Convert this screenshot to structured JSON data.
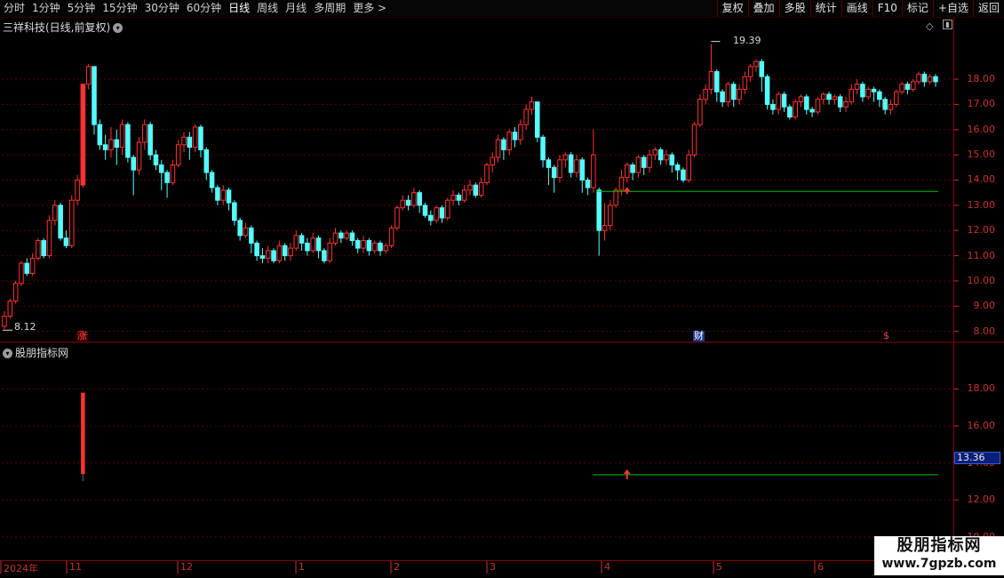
{
  "toolbar": {
    "periods": [
      "分时",
      "1分钟",
      "5分钟",
      "15分钟",
      "30分钟",
      "60分钟",
      "日线",
      "周线",
      "月线",
      "多周期",
      "更多 >"
    ],
    "active_period": "日线",
    "tools": [
      "复权",
      "叠加",
      "多股",
      "统计",
      "画线",
      "F10",
      "标记",
      "+自选",
      "返回"
    ]
  },
  "price_panel": {
    "title": "三祥科技(日线,前复权)",
    "high_annotation": "19.39",
    "low_annotation": "8.12",
    "markers": {
      "limit_up": "涨",
      "finance": "财",
      "dividend": "$"
    }
  },
  "indicator_panel": {
    "title": "股朋指标网",
    "current_value": "13.36"
  },
  "timeline": [
    "2024年",
    "11",
    "12",
    "1",
    "2",
    "3",
    "4",
    "5",
    "6"
  ],
  "watermark": {
    "name": "股朋指标网",
    "url": "www.7gpzb.com"
  },
  "colors": {
    "up": "#ff3232",
    "down": "#54ffff",
    "line": "#00c000",
    "grid": "#5a0000",
    "axis": "#c83232"
  },
  "chart_data": [
    {
      "type": "candlestick",
      "title": "三祥科技(日线,前复权)",
      "y_ticks": [
        8.0,
        9.0,
        10.0,
        11.0,
        12.0,
        13.0,
        14.0,
        15.0,
        16.0,
        17.0,
        18.0
      ],
      "ylim": [
        7.6,
        19.8
      ],
      "x_months": [
        "2024年",
        "11",
        "12",
        "1",
        "2",
        "3",
        "4",
        "5",
        "6"
      ],
      "max_price": 19.39,
      "min_price": 8.12,
      "reference_line": 13.55,
      "candles": [
        [
          8.2,
          8.6,
          8.1,
          8.8
        ],
        [
          8.6,
          9.2,
          8.5,
          9.3
        ],
        [
          9.2,
          9.9,
          9.1,
          10.0
        ],
        [
          9.9,
          10.7,
          9.8,
          10.8
        ],
        [
          10.7,
          10.3,
          10.2,
          10.9
        ],
        [
          10.3,
          10.9,
          10.2,
          11.1
        ],
        [
          10.9,
          11.6,
          10.8,
          11.7
        ],
        [
          11.6,
          11.0,
          10.9,
          11.7
        ],
        [
          11.0,
          12.4,
          10.9,
          12.6
        ],
        [
          12.4,
          13.0,
          12.2,
          13.2
        ],
        [
          13.0,
          11.7,
          11.6,
          13.1
        ],
        [
          11.7,
          11.4,
          11.3,
          12.0
        ],
        [
          11.4,
          13.2,
          11.3,
          13.4
        ],
        [
          13.2,
          14.0,
          13.0,
          14.2
        ],
        [
          13.8,
          17.8,
          13.7,
          17.8
        ],
        [
          17.8,
          18.5,
          17.6,
          18.6
        ],
        [
          18.5,
          16.2,
          15.8,
          18.5
        ],
        [
          16.2,
          15.4,
          15.2,
          16.4
        ],
        [
          15.4,
          15.2,
          14.8,
          15.8
        ],
        [
          15.2,
          15.6,
          14.9,
          16.1
        ],
        [
          15.6,
          15.3,
          14.6,
          16.0
        ],
        [
          15.3,
          16.2,
          15.0,
          16.4
        ],
        [
          16.2,
          14.9,
          14.7,
          16.3
        ],
        [
          14.9,
          14.4,
          13.4,
          15.0
        ],
        [
          14.4,
          15.5,
          14.2,
          15.7
        ],
        [
          15.5,
          16.2,
          15.2,
          16.4
        ],
        [
          16.2,
          15.0,
          14.8,
          16.3
        ],
        [
          15.0,
          14.6,
          14.4,
          15.2
        ],
        [
          14.6,
          14.3,
          13.6,
          14.8
        ],
        [
          14.3,
          13.9,
          13.3,
          14.4
        ],
        [
          13.9,
          14.6,
          13.8,
          14.8
        ],
        [
          14.6,
          15.4,
          14.5,
          15.6
        ],
        [
          15.4,
          15.7,
          15.1,
          15.9
        ],
        [
          15.7,
          15.3,
          14.8,
          15.9
        ],
        [
          15.3,
          16.1,
          15.1,
          16.2
        ],
        [
          16.1,
          15.2,
          14.9,
          16.2
        ],
        [
          15.2,
          14.3,
          14.0,
          15.3
        ],
        [
          14.3,
          13.7,
          13.5,
          14.4
        ],
        [
          13.7,
          13.2,
          13.0,
          13.8
        ],
        [
          13.2,
          13.6,
          13.0,
          13.8
        ],
        [
          13.6,
          13.1,
          12.8,
          13.7
        ],
        [
          13.1,
          12.4,
          12.2,
          13.2
        ],
        [
          12.4,
          11.8,
          11.6,
          12.5
        ],
        [
          11.8,
          12.1,
          11.7,
          12.3
        ],
        [
          12.1,
          11.5,
          11.1,
          12.2
        ],
        [
          11.5,
          11.0,
          10.8,
          11.6
        ],
        [
          11.0,
          10.9,
          10.7,
          11.3
        ],
        [
          10.9,
          11.2,
          10.7,
          11.4
        ],
        [
          11.2,
          10.8,
          10.7,
          11.3
        ],
        [
          10.8,
          11.4,
          10.7,
          11.6
        ],
        [
          11.4,
          11.0,
          10.8,
          11.5
        ],
        [
          11.0,
          11.3,
          10.8,
          11.5
        ],
        [
          11.3,
          11.8,
          11.2,
          12.0
        ],
        [
          11.8,
          11.5,
          11.2,
          11.9
        ],
        [
          11.5,
          11.2,
          11.0,
          11.7
        ],
        [
          11.2,
          11.7,
          11.1,
          11.9
        ],
        [
          11.7,
          11.2,
          10.9,
          11.8
        ],
        [
          11.2,
          10.8,
          10.7,
          11.3
        ],
        [
          10.8,
          11.5,
          10.7,
          11.7
        ],
        [
          11.5,
          11.9,
          11.4,
          12.1
        ],
        [
          11.9,
          11.7,
          11.5,
          12.0
        ],
        [
          11.7,
          11.9,
          11.6,
          12.0
        ],
        [
          11.9,
          11.6,
          11.4,
          12.0
        ],
        [
          11.6,
          11.3,
          11.1,
          11.7
        ],
        [
          11.3,
          11.6,
          11.1,
          11.8
        ],
        [
          11.6,
          11.2,
          11.0,
          11.7
        ],
        [
          11.2,
          11.5,
          11.1,
          11.6
        ],
        [
          11.5,
          11.2,
          11.0,
          11.6
        ],
        [
          11.2,
          11.4,
          11.1,
          11.5
        ],
        [
          11.4,
          12.1,
          11.3,
          12.2
        ],
        [
          12.1,
          12.9,
          12.0,
          13.0
        ],
        [
          12.9,
          13.2,
          12.8,
          13.4
        ],
        [
          13.2,
          13.0,
          12.8,
          13.4
        ],
        [
          13.0,
          13.5,
          12.9,
          13.7
        ],
        [
          13.5,
          13.0,
          12.7,
          13.6
        ],
        [
          13.0,
          12.6,
          12.5,
          13.1
        ],
        [
          12.6,
          12.4,
          12.2,
          12.8
        ],
        [
          12.4,
          12.9,
          12.3,
          13.0
        ],
        [
          12.9,
          12.5,
          12.3,
          13.0
        ],
        [
          12.5,
          13.2,
          12.4,
          13.3
        ],
        [
          13.2,
          13.4,
          13.0,
          13.6
        ],
        [
          13.4,
          13.2,
          13.0,
          13.5
        ],
        [
          13.2,
          13.6,
          13.1,
          13.8
        ],
        [
          13.6,
          13.8,
          13.4,
          14.0
        ],
        [
          13.8,
          13.4,
          13.3,
          13.9
        ],
        [
          13.4,
          13.9,
          13.3,
          14.1
        ],
        [
          13.9,
          14.6,
          13.8,
          14.7
        ],
        [
          14.6,
          14.9,
          14.3,
          15.1
        ],
        [
          14.9,
          15.6,
          14.7,
          15.8
        ],
        [
          15.6,
          15.2,
          14.8,
          15.7
        ],
        [
          15.2,
          15.9,
          15.0,
          16.0
        ],
        [
          15.9,
          15.6,
          15.3,
          16.1
        ],
        [
          15.6,
          16.2,
          15.4,
          16.4
        ],
        [
          16.2,
          16.8,
          16.0,
          17.0
        ],
        [
          16.8,
          17.1,
          16.6,
          17.3
        ],
        [
          17.1,
          15.7,
          15.5,
          17.1
        ],
        [
          15.7,
          14.8,
          14.5,
          15.8
        ],
        [
          14.8,
          14.5,
          13.8,
          14.9
        ],
        [
          14.5,
          14.1,
          13.5,
          14.6
        ],
        [
          14.1,
          14.8,
          13.9,
          15.0
        ],
        [
          14.8,
          15.0,
          14.5,
          15.1
        ],
        [
          15.0,
          14.3,
          14.1,
          15.1
        ],
        [
          14.3,
          14.8,
          14.1,
          15.0
        ],
        [
          14.8,
          14.0,
          13.5,
          14.9
        ],
        [
          14.0,
          13.7,
          13.4,
          14.1
        ],
        [
          13.7,
          15.0,
          13.5,
          16.0
        ],
        [
          13.6,
          12.0,
          11.0,
          13.7
        ],
        [
          12.0,
          12.2,
          11.6,
          13.1
        ],
        [
          12.2,
          13.0,
          12.0,
          13.2
        ],
        [
          13.0,
          13.6,
          12.9,
          13.7
        ],
        [
          13.6,
          14.1,
          13.4,
          14.4
        ],
        [
          14.1,
          14.6,
          13.9,
          14.7
        ],
        [
          14.6,
          14.3,
          14.0,
          14.7
        ],
        [
          14.3,
          14.9,
          14.1,
          15.0
        ],
        [
          14.9,
          14.5,
          14.2,
          15.0
        ],
        [
          14.5,
          15.0,
          14.3,
          15.2
        ],
        [
          15.0,
          15.2,
          14.8,
          15.3
        ],
        [
          15.2,
          14.8,
          14.6,
          15.3
        ],
        [
          14.8,
          15.0,
          14.6,
          15.2
        ],
        [
          15.0,
          14.6,
          14.3,
          15.1
        ],
        [
          14.6,
          14.4,
          14.0,
          14.7
        ],
        [
          14.4,
          14.0,
          13.9,
          14.5
        ],
        [
          14.0,
          15.0,
          13.9,
          15.2
        ],
        [
          15.0,
          16.2,
          14.9,
          16.3
        ],
        [
          16.2,
          17.2,
          16.1,
          17.4
        ],
        [
          17.2,
          17.6,
          17.0,
          17.8
        ],
        [
          17.6,
          18.3,
          17.4,
          19.39
        ],
        [
          18.3,
          17.5,
          17.1,
          18.4
        ],
        [
          17.5,
          17.1,
          16.9,
          17.6
        ],
        [
          17.1,
          17.8,
          16.9,
          17.9
        ],
        [
          17.8,
          17.2,
          16.9,
          17.9
        ],
        [
          17.2,
          17.6,
          17.0,
          17.8
        ],
        [
          17.6,
          18.1,
          17.4,
          18.3
        ],
        [
          18.1,
          18.5,
          17.9,
          18.6
        ],
        [
          18.5,
          18.7,
          18.3,
          18.8
        ],
        [
          18.7,
          18.1,
          17.5,
          18.8
        ],
        [
          18.1,
          17.0,
          16.8,
          18.2
        ],
        [
          17.0,
          16.8,
          16.6,
          17.2
        ],
        [
          16.8,
          17.4,
          16.6,
          17.5
        ],
        [
          17.4,
          16.9,
          16.7,
          17.5
        ],
        [
          16.9,
          16.5,
          16.4,
          17.0
        ],
        [
          16.5,
          17.1,
          16.4,
          17.2
        ],
        [
          17.1,
          17.3,
          16.9,
          17.4
        ],
        [
          17.3,
          16.8,
          16.6,
          17.4
        ],
        [
          16.8,
          16.7,
          16.5,
          16.9
        ],
        [
          16.7,
          17.2,
          16.6,
          17.3
        ],
        [
          17.2,
          17.4,
          17.0,
          17.5
        ],
        [
          17.4,
          17.2,
          17.0,
          17.5
        ],
        [
          17.2,
          17.3,
          17.0,
          17.4
        ],
        [
          17.3,
          16.9,
          16.7,
          17.4
        ],
        [
          16.9,
          17.1,
          16.7,
          17.3
        ],
        [
          17.1,
          17.6,
          17.0,
          17.8
        ],
        [
          17.6,
          17.8,
          17.4,
          18.0
        ],
        [
          17.8,
          17.3,
          17.1,
          17.9
        ],
        [
          17.3,
          17.6,
          17.2,
          17.7
        ],
        [
          17.6,
          17.5,
          17.1,
          17.7
        ],
        [
          17.5,
          17.2,
          16.9,
          17.6
        ],
        [
          17.2,
          16.8,
          16.6,
          17.3
        ],
        [
          16.8,
          17.0,
          16.6,
          17.2
        ],
        [
          17.0,
          17.5,
          16.9,
          17.6
        ],
        [
          17.5,
          17.8,
          17.4,
          17.9
        ],
        [
          17.8,
          17.6,
          17.4,
          17.9
        ],
        [
          17.6,
          17.9,
          17.5,
          18.0
        ],
        [
          17.9,
          18.2,
          17.8,
          18.3
        ],
        [
          18.2,
          17.9,
          17.7,
          18.3
        ],
        [
          17.9,
          18.1,
          17.8,
          18.2
        ],
        [
          18.1,
          17.9,
          17.7,
          18.2
        ]
      ]
    },
    {
      "type": "bar",
      "title": "股朋指标网",
      "y_ticks": [
        10.0,
        12.0,
        14.0,
        16.0,
        18.0
      ],
      "ylim": [
        9.6,
        19.9
      ],
      "signal_bar": {
        "from": 13.4,
        "to": 17.8
      },
      "reference_line": 13.36,
      "arrow_value": 13.36
    }
  ]
}
